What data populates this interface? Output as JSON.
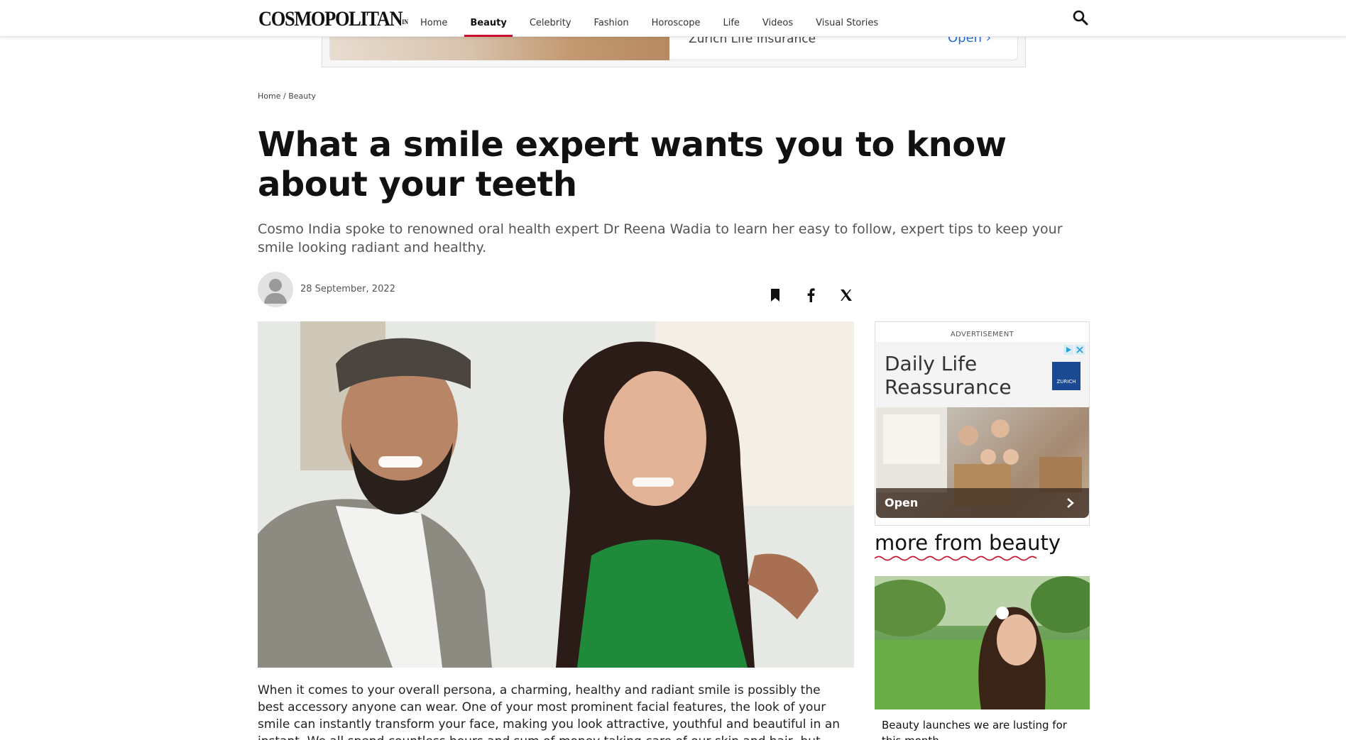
{
  "header": {
    "logo": "COSMOPOLITAN",
    "logo_suffix": "IN",
    "nav": [
      "Home",
      "Beauty",
      "Celebrity",
      "Fashion",
      "Horoscope",
      "Life",
      "Videos",
      "Visual Stories"
    ],
    "active_nav": "Beauty",
    "search_icon": "search-icon"
  },
  "top_ad": {
    "title": "Zurich Life Insurance",
    "open": "Open"
  },
  "breadcrumb": {
    "home": "Home",
    "separator": "/",
    "section": "Beauty"
  },
  "article": {
    "headline": "What a smile expert wants you to know about your teeth",
    "subhead": "Cosmo India spoke to renowned oral health expert Dr Reena Wadia to learn her easy to follow, expert tips to keep your smile looking radiant and healthy.",
    "date": "28 September, 2022",
    "share_icons": [
      "bookmark-icon",
      "facebook-icon",
      "x-icon"
    ],
    "body": "When it comes to your overall persona, a charming, healthy and radiant smile is possibly the best accessory anyone can wear. One of your most prominent facial features, the look of your smile can instantly transform your face, making you look attractive, youthful and beautiful in an instant. We all spend countless hours and sum of money taking care of our skin and hair, but many-a-times we might tend to overlook the importance of"
  },
  "sidebar_ad": {
    "label": "ADVERTISEMENT",
    "title": "Daily Life Reassurance",
    "brand": "ZURICH",
    "open": "Open"
  },
  "more": {
    "title": "more from beauty",
    "card_title": "Beauty launches we are lusting for this month"
  },
  "colors": {
    "accent": "#c8102e",
    "link_blue": "#2a6fd6"
  }
}
